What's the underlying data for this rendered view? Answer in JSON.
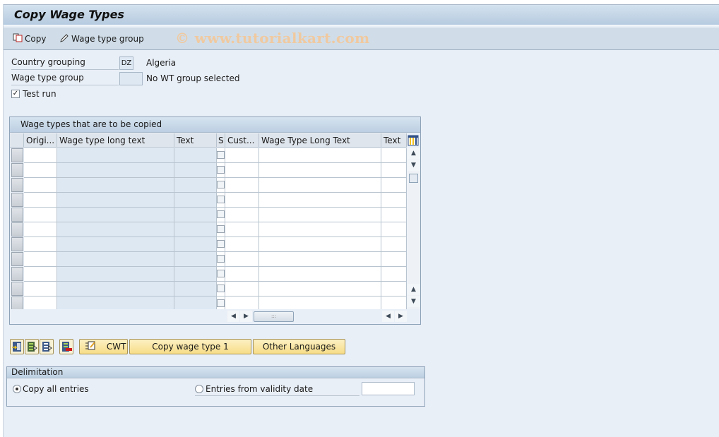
{
  "title": "Copy Wage Types",
  "toolbar": {
    "copy_label": "Copy",
    "copy_icon": "copy-icon",
    "wage_type_group_label": "Wage type group",
    "wage_type_group_icon": "pencil-icon",
    "watermark": "© www.tutorialkart.com"
  },
  "form": {
    "country_grouping_label": "Country grouping",
    "country_grouping_value": "DZ",
    "country_grouping_text": "Algeria",
    "wage_type_group_label": "Wage type group",
    "wage_type_group_value": "",
    "wage_type_group_text": "No WT group selected",
    "test_run_label": "Test run",
    "test_run_checked": true
  },
  "grid": {
    "title": "Wage types that are to be copied",
    "columns": [
      "Origi...",
      "Wage type long text",
      "Text",
      "S",
      "Cust...",
      "Wage Type Long Text",
      "Text"
    ],
    "row_count": 11,
    "rows": [
      [],
      [],
      [],
      [],
      [],
      [],
      [],
      [],
      [],
      [],
      []
    ],
    "layout_icon": "column-layout-icon",
    "hscroll_thumb_glyph": ":::"
  },
  "buttons": {
    "icon_buttons": [
      "insert-row-icon",
      "select-block-icon",
      "select-all-icon",
      "delete-row-icon"
    ],
    "cwt_icon": "edit-list-icon",
    "cwt_label": "CWT",
    "copy_wage_type_label": "Copy wage type 1",
    "other_languages_label": "Other Languages"
  },
  "delimitation": {
    "title": "Delimitation",
    "copy_all_label": "Copy all entries",
    "copy_all_selected": true,
    "validity_label": "Entries from validity date",
    "validity_selected": false,
    "validity_date_value": ""
  }
}
